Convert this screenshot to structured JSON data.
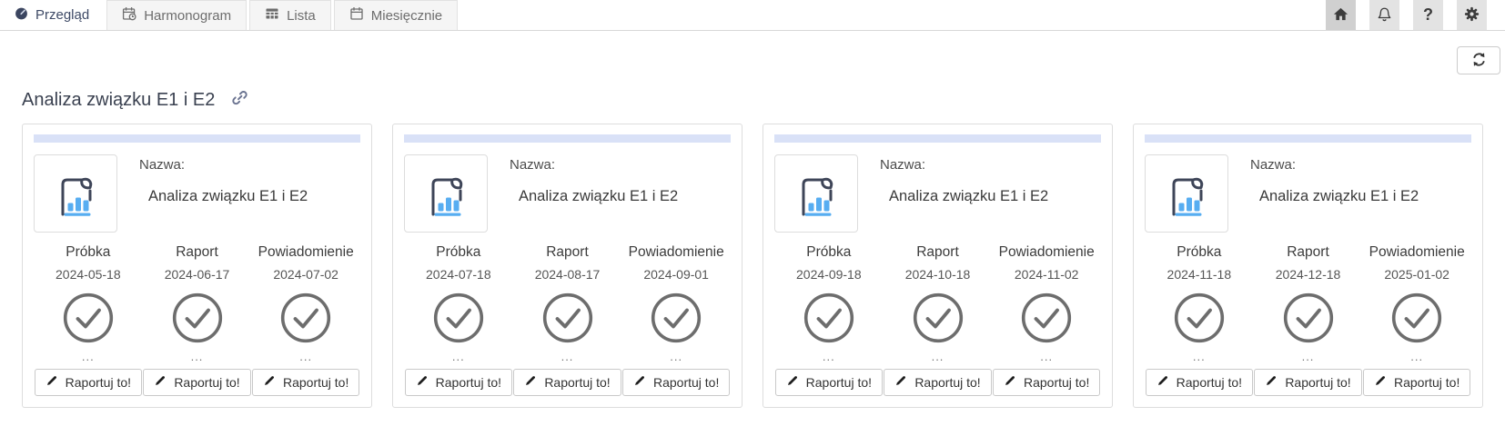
{
  "tabs": [
    {
      "label": "Przegląd",
      "icon": "dashboard-icon",
      "active": true
    },
    {
      "label": "Harmonogram",
      "icon": "schedule-icon",
      "active": false
    },
    {
      "label": "Lista",
      "icon": "table-icon",
      "active": false
    },
    {
      "label": "Miesięcznie",
      "icon": "calendar-icon",
      "active": false
    }
  ],
  "header_actions": [
    {
      "name": "home",
      "icon": "home-icon"
    },
    {
      "name": "notifications",
      "icon": "bell-icon"
    },
    {
      "name": "help",
      "icon": "question-icon",
      "glyph": "?"
    },
    {
      "name": "settings",
      "icon": "gear-icon"
    }
  ],
  "toolbar": {
    "refresh_icon": "refresh-icon"
  },
  "page": {
    "title": "Analiza związku E1 i E2",
    "link_icon": "link-icon"
  },
  "cards": [
    {
      "progress_percent": 100,
      "name_label": "Nazwa:",
      "name": "Analiza związku E1 i E2",
      "milestones": [
        {
          "label": "Próbka",
          "date": "2024-05-18",
          "status": "done",
          "more": "...",
          "button": "Raportuj to!"
        },
        {
          "label": "Raport",
          "date": "2024-06-17",
          "status": "done",
          "more": "...",
          "button": "Raportuj to!"
        },
        {
          "label": "Powiadomienie",
          "date": "2024-07-02",
          "status": "done",
          "more": "...",
          "button": "Raportuj to!"
        }
      ]
    },
    {
      "progress_percent": 100,
      "name_label": "Nazwa:",
      "name": "Analiza związku E1 i E2",
      "milestones": [
        {
          "label": "Próbka",
          "date": "2024-07-18",
          "status": "done",
          "more": "...",
          "button": "Raportuj to!"
        },
        {
          "label": "Raport",
          "date": "2024-08-17",
          "status": "done",
          "more": "...",
          "button": "Raportuj to!"
        },
        {
          "label": "Powiadomienie",
          "date": "2024-09-01",
          "status": "done",
          "more": "...",
          "button": "Raportuj to!"
        }
      ]
    },
    {
      "progress_percent": 100,
      "name_label": "Nazwa:",
      "name": "Analiza związku E1 i E2",
      "milestones": [
        {
          "label": "Próbka",
          "date": "2024-09-18",
          "status": "done",
          "more": "...",
          "button": "Raportuj to!"
        },
        {
          "label": "Raport",
          "date": "2024-10-18",
          "status": "done",
          "more": "...",
          "button": "Raportuj to!"
        },
        {
          "label": "Powiadomienie",
          "date": "2024-11-02",
          "status": "done",
          "more": "...",
          "button": "Raportuj to!"
        }
      ]
    },
    {
      "progress_percent": 100,
      "name_label": "Nazwa:",
      "name": "Analiza związku E1 i E2",
      "milestones": [
        {
          "label": "Próbka",
          "date": "2024-11-18",
          "status": "done",
          "more": "...",
          "button": "Raportuj to!"
        },
        {
          "label": "Raport",
          "date": "2024-12-18",
          "status": "done",
          "more": "...",
          "button": "Raportuj to!"
        },
        {
          "label": "Powiadomienie",
          "date": "2025-01-02",
          "status": "done",
          "more": "...",
          "button": "Raportuj to!"
        }
      ]
    }
  ],
  "colors": {
    "accent_blue": "#57adf1",
    "progress_bar": "#d9e1f7",
    "check_gray": "#6d6d6d",
    "active_tab_text": "#3e4a66"
  }
}
